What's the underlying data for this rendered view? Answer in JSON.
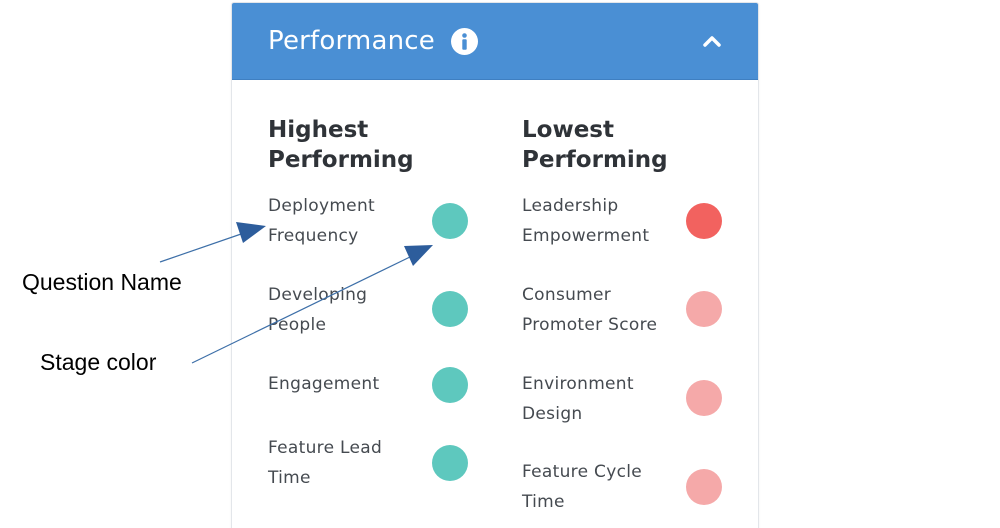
{
  "panel": {
    "title": "Performance",
    "info_icon": "info-circle-icon",
    "collapse_icon": "chevron-up-icon",
    "header_color": "#4a8fd4"
  },
  "highest": {
    "heading_line1": "Highest",
    "heading_line2": "Performing",
    "items": [
      {
        "line1": "Deployment",
        "line2": "Frequency",
        "color": "#5ec8be"
      },
      {
        "line1": "Developing",
        "line2": "People",
        "color": "#5ec8be"
      },
      {
        "line1": "Engagement",
        "line2": "",
        "color": "#5ec8be"
      },
      {
        "line1": "Feature Lead",
        "line2": "Time",
        "color": "#5ec8be"
      }
    ]
  },
  "lowest": {
    "heading_line1": "Lowest",
    "heading_line2": "Performing",
    "items": [
      {
        "line1": "Leadership",
        "line2": "Empowerment",
        "color": "#f2625f"
      },
      {
        "line1": "Consumer",
        "line2": "Promoter Score",
        "color": "#f5a9a9"
      },
      {
        "line1": "Environment",
        "line2": "Design",
        "color": "#f5a9a9"
      },
      {
        "line1": "Feature Cycle",
        "line2": "Time",
        "color": "#f5a9a9"
      }
    ]
  },
  "annotations": {
    "question_name": "Question Name",
    "stage_color": "Stage color"
  }
}
